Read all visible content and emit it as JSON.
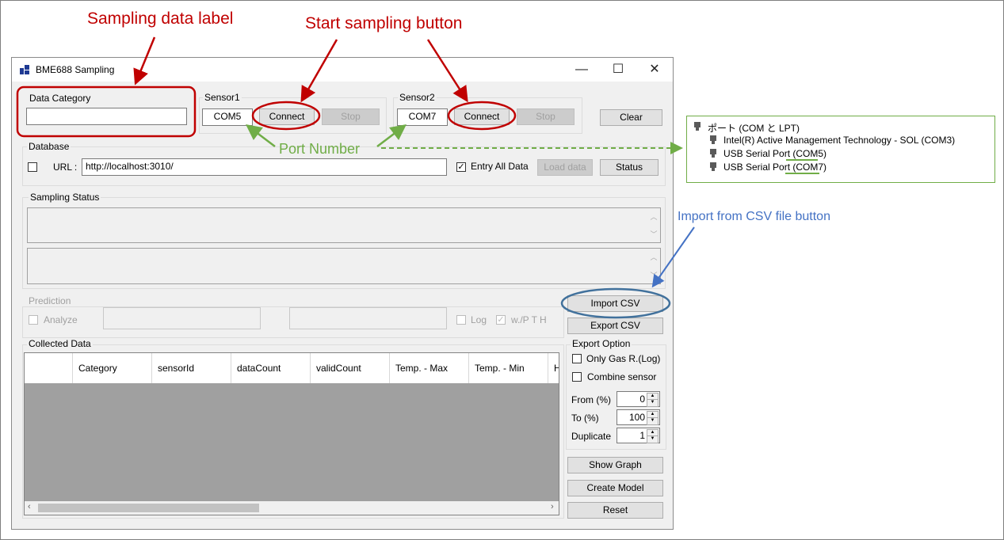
{
  "annotations": {
    "sampling_label": "Sampling data label",
    "start_sampling": "Start sampling button",
    "port_number": "Port Number",
    "import_csv": "Import from CSV file button"
  },
  "window": {
    "title": "BME688 Sampling",
    "minimize": "—",
    "maximize": "☐",
    "close": "✕"
  },
  "data_category": {
    "label": "Data Category",
    "value": ""
  },
  "sensor1": {
    "label": "Sensor1",
    "port": "COM5",
    "connect": "Connect",
    "stop": "Stop"
  },
  "sensor2": {
    "label": "Sensor2",
    "port": "COM7",
    "connect": "Connect",
    "stop": "Stop"
  },
  "clear_button": "Clear",
  "database": {
    "label": "Database",
    "url_label": "URL :",
    "url_value": "http://localhost:3010/",
    "entry_all": "Entry All Data",
    "load_data": "Load data",
    "status": "Status"
  },
  "sampling_status": {
    "label": "Sampling Status"
  },
  "prediction": {
    "label": "Prediction",
    "analyze": "Analyze",
    "log": "Log",
    "wpth": "w./P T H"
  },
  "import_csv": "Import CSV",
  "export_csv": "Export CSV",
  "collected_data": {
    "label": "Collected Data",
    "columns": [
      "",
      "Category",
      "sensorId",
      "dataCount",
      "validCount",
      "Temp. - Max",
      "Temp. - Min",
      "H"
    ]
  },
  "export_option": {
    "label": "Export Option",
    "only_gas": "Only Gas R.(Log)",
    "combine": "Combine sensor",
    "from_label": "From (%)",
    "from_value": "0",
    "to_label": "To (%)",
    "to_value": "100",
    "dup_label": "Duplicate",
    "dup_value": "1"
  },
  "show_graph": "Show Graph",
  "create_model": "Create Model",
  "reset": "Reset",
  "device_manager": {
    "category": "ポート (COM と LPT)",
    "items": [
      "Intel(R) Active Management Technology - SOL (COM3)",
      "USB Serial Port (COM5)",
      "USB Serial Port (COM7)"
    ]
  },
  "colors": {
    "annotation_red": "#c00000",
    "annotation_green": "#70ad47",
    "annotation_blue": "#4472c4",
    "grid_background": "#a0a0a0"
  },
  "icons": {
    "app": "app-icon",
    "port": "port-device-icon",
    "scroll_up": "scroll-up-arrow-icon",
    "scroll_down": "scroll-down-arrow-icon"
  }
}
